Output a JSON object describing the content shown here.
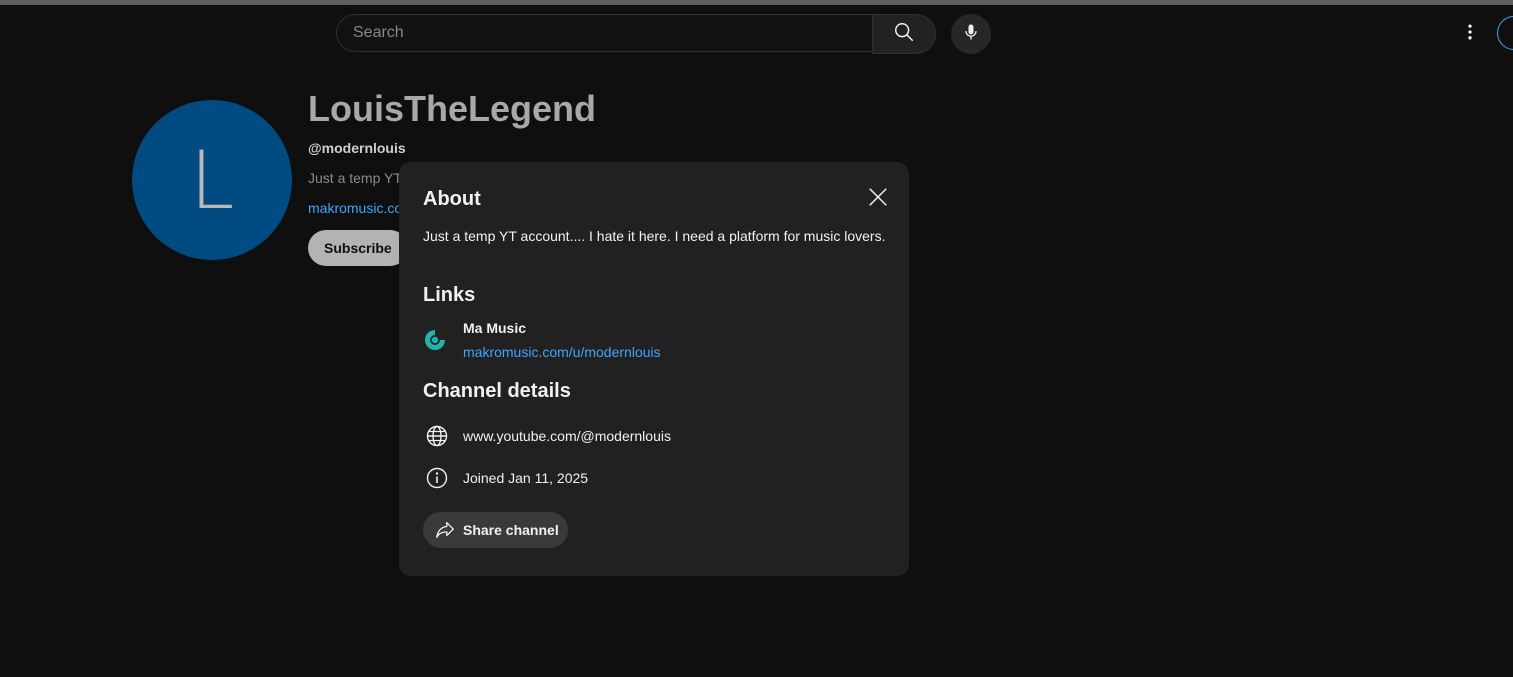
{
  "masthead": {
    "search_placeholder": "Search",
    "icons": {
      "search": "search-icon",
      "voice": "microphone-icon",
      "more": "more-vertical-icon"
    }
  },
  "channel": {
    "avatar_letter": "L",
    "avatar_color": "#004c82",
    "name": "LouisTheLegend",
    "handle": "@modernlouis",
    "description_preview": "Just a temp YT",
    "link_preview": "makromusic.co",
    "subscribe_label": "Subscribe"
  },
  "about_dialog": {
    "title": "About",
    "description": "Just a temp YT account.... I hate it here. I need a platform for music lovers.",
    "links_heading": "Links",
    "links": [
      {
        "title": "Ma Music",
        "url": "makromusic.com/u/modernlouis",
        "icon": "makromusic-logo-icon",
        "icon_color": "#1fb5ad"
      }
    ],
    "details_heading": "Channel details",
    "details": [
      {
        "icon": "globe-icon",
        "text": "www.youtube.com/@modernlouis"
      },
      {
        "icon": "info-icon",
        "text": "Joined Jan 11, 2025"
      }
    ],
    "share_label": "Share channel",
    "accent_link_color": "#3ea6ff"
  }
}
